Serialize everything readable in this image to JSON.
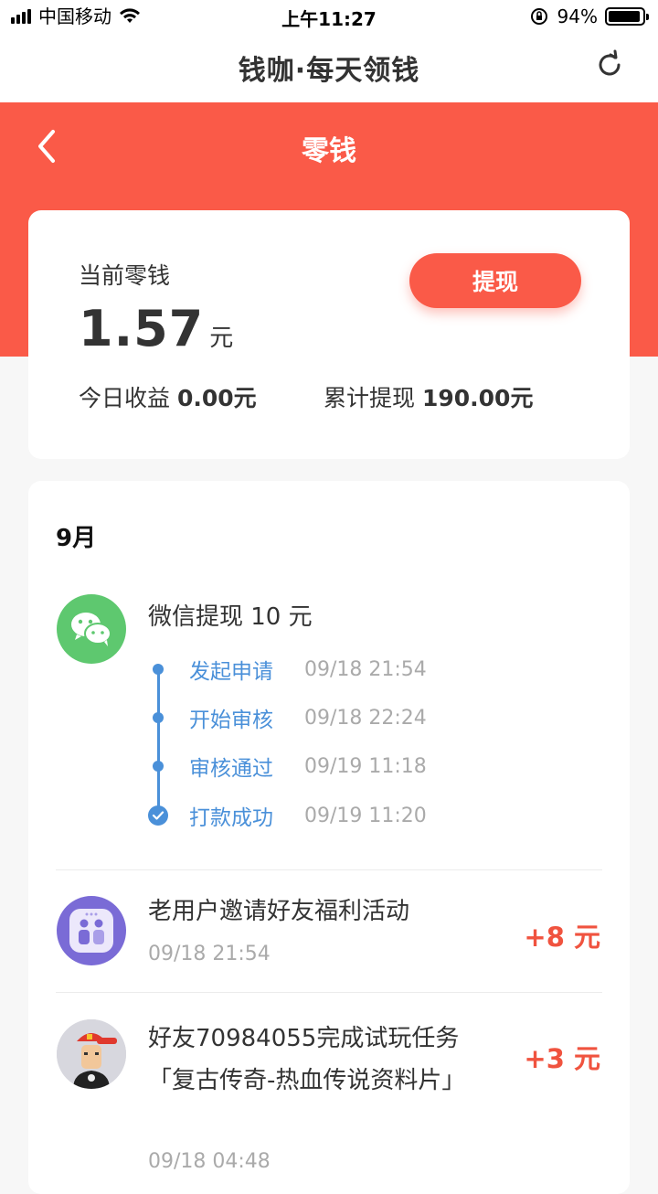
{
  "status_bar": {
    "carrier": "中国移动",
    "time": "上午11:27",
    "battery": "94%",
    "battery_level": 0.94
  },
  "header": {
    "app_title": "钱咖·每天领钱",
    "refresh_icon": "refresh-icon"
  },
  "page": {
    "title": "零钱",
    "back_icon": "back-chevron-icon",
    "accent": "#fa5a48"
  },
  "balance_card": {
    "label": "当前零钱",
    "value": "1.57",
    "unit": "元",
    "withdraw_label": "提现",
    "today_label": "今日收益",
    "today_value": "0.00元",
    "total_label": "累计提现",
    "total_value": "190.00元"
  },
  "records": {
    "month": "9月",
    "withdrawal": {
      "icon": "wechat-icon",
      "title": "微信提现 10 元",
      "steps": [
        {
          "label": "发起申请",
          "time": "09/18 21:54"
        },
        {
          "label": "开始审核",
          "time": "09/18 22:24"
        },
        {
          "label": "审核通过",
          "time": "09/19 11:18"
        },
        {
          "label": "打款成功",
          "time": "09/19 11:20"
        }
      ]
    },
    "items": [
      {
        "title": "老用户邀请好友福利活动",
        "time": "09/18 21:54",
        "amount": "+8 元",
        "icon": "invite-friends-icon"
      },
      {
        "title": "好友70984055完成试玩任务「复古传奇-热血传说资料片」",
        "time": "09/18 04:48",
        "amount": "+3 元",
        "icon": "game-avatar-icon"
      }
    ]
  }
}
